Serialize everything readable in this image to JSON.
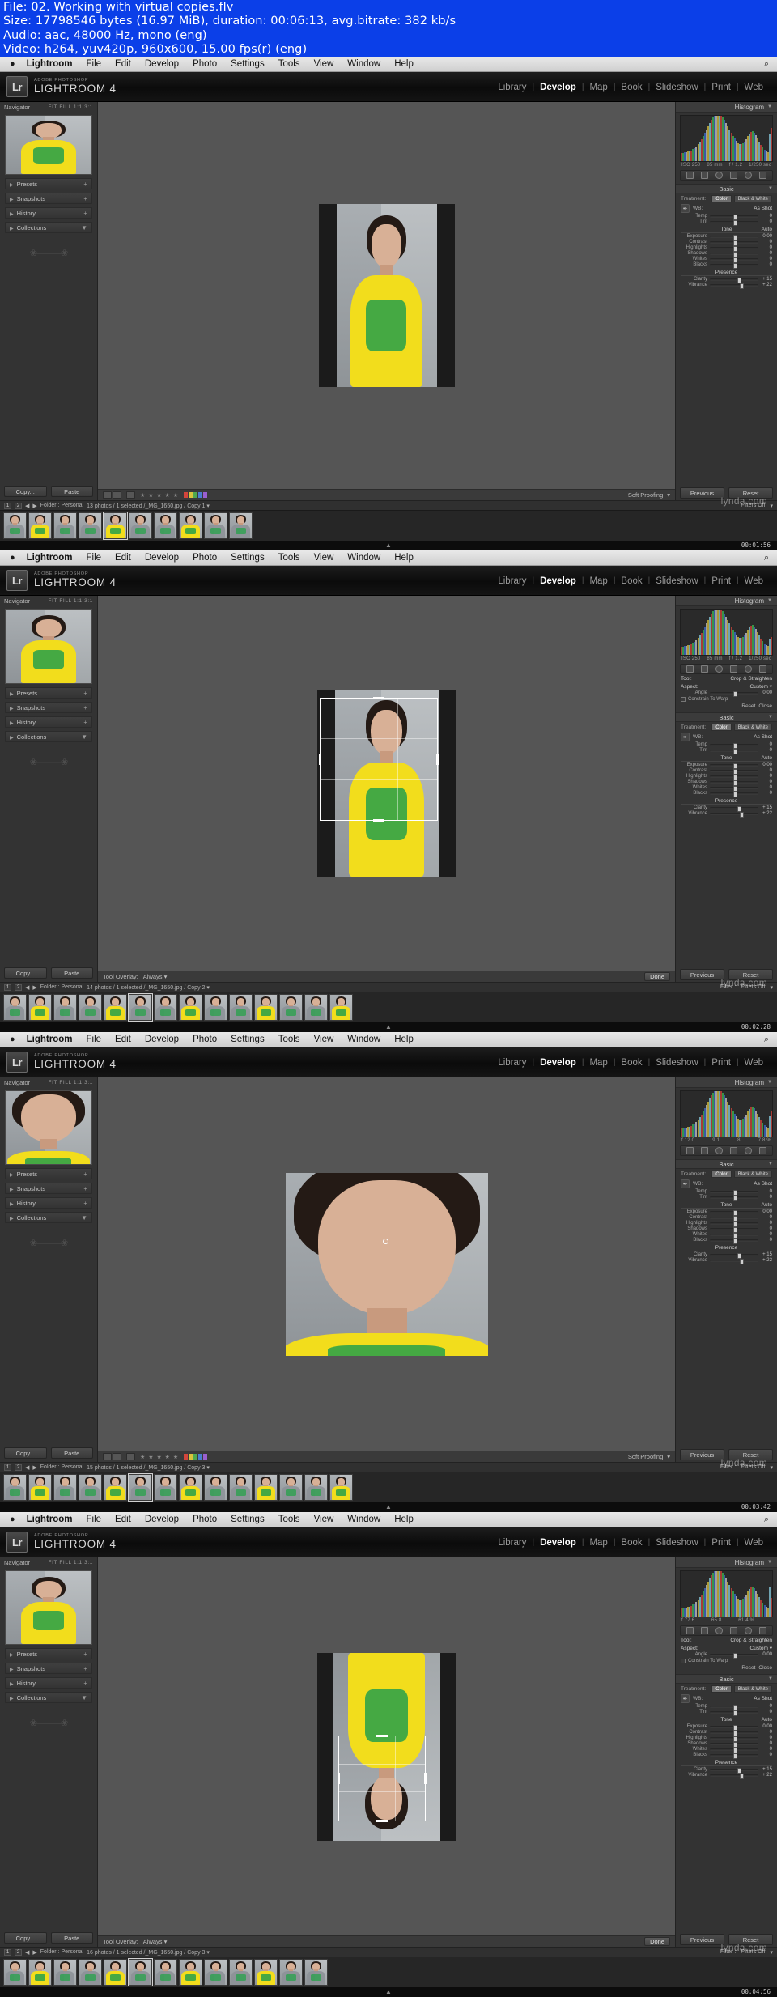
{
  "mediainfo": {
    "line1": "File: 02. Working with virtual copies.flv",
    "line2": "Size: 17798546 bytes (16.97 MiB), duration: 00:06:13, avg.bitrate: 382 kb/s",
    "line3": "Audio: aac, 48000 Hz, mono (eng)",
    "line4": "Video: h264, yuv420p, 960x600, 15.00 fps(r) (eng)"
  },
  "macmenu": {
    "apple": "apple-logo",
    "items": [
      "Lightroom",
      "File",
      "Edit",
      "Develop",
      "Photo",
      "Settings",
      "Tools",
      "View",
      "Window",
      "Help"
    ],
    "right_glyph": "search-icon"
  },
  "brand": {
    "logo": "Lr",
    "superscript": "ADOBE PHOTOSHOP",
    "name": "LIGHTROOM 4"
  },
  "modules": {
    "items": [
      "Library",
      "Develop",
      "Map",
      "Book",
      "Slideshow",
      "Print",
      "Web"
    ],
    "active": "Develop"
  },
  "left_panel": {
    "navigator_title": "Navigator",
    "zoom_levels": "FIT  FILL  1:1  3:1",
    "rows": [
      "Presets",
      "Snapshots",
      "History",
      "Collections"
    ],
    "copy_label": "Copy...",
    "paste_label": "Paste"
  },
  "right_panel": {
    "histogram_title": "Histogram",
    "basic_title": "Basic",
    "tool_label": "Tool:",
    "tool_value": "Crop & Straighten",
    "aspect_label": "Aspect:",
    "aspect_value": "Custom",
    "angle_label": "Angle",
    "angle_value": "0.00",
    "constrain_label": "Constrain To Warp",
    "reset_label": "Reset",
    "close_label": "Close",
    "treatment_label": "Treatment:",
    "treatment_color": "Color",
    "treatment_bw": "Black & White",
    "wb_label": "WB:",
    "wb_value": "As Shot",
    "temp_label": "Temp",
    "tint_label": "Tint",
    "tone_label": "Tone",
    "auto_label": "Auto",
    "presence_label": "Presence",
    "previous_label": "Previous",
    "reset_button": "Reset",
    "done_label": "Done",
    "sliders_tone": [
      {
        "name": "Exposure",
        "value": "0.00"
      },
      {
        "name": "Contrast",
        "value": "0"
      },
      {
        "name": "Highlights",
        "value": "0"
      },
      {
        "name": "Shadows",
        "value": "0"
      },
      {
        "name": "Whites",
        "value": "0"
      },
      {
        "name": "Blacks",
        "value": "0"
      }
    ],
    "sliders_presence": [
      {
        "name": "Clarity",
        "value": "+ 15"
      },
      {
        "name": "Vibrance",
        "value": "+ 22"
      }
    ],
    "wb_sliders": [
      {
        "name": "Temp",
        "value": "0"
      },
      {
        "name": "Tint",
        "value": "0"
      }
    ]
  },
  "toolbar": {
    "soft_proofing": "Soft Proofing",
    "tool_overlay_label": "Tool Overlay:",
    "tool_overlay_value": "Always",
    "done": "Done",
    "rating_stars": "★ ★ ★ ★ ★"
  },
  "shots": [
    {
      "id": "shot-1",
      "hist_meta_left": "ISO 250",
      "hist_meta_mid": "85 mm",
      "hist_meta_f": "f / 1.2",
      "hist_meta_right": "1/250 sec",
      "filmstrip_folder": "Folder : Personal",
      "filmstrip_count": "13 photos / 1 selected /_MG_1650.jpg / Copy 1",
      "filter_label": "Filters Off",
      "timecode": "00:01:56",
      "watermark": "lynda.com",
      "mode": "normal",
      "thumbs": 10,
      "selected_thumb": 4
    },
    {
      "id": "shot-2",
      "hist_meta_left": "ISO 250",
      "hist_meta_mid": "85 mm",
      "hist_meta_f": "f / 1.2",
      "hist_meta_right": "1/250 sec",
      "filmstrip_folder": "Folder : Personal",
      "filmstrip_count": "14 photos / 1 selected /_MG_1650.jpg / Copy 2",
      "filter_label": "Filters Off",
      "filter_prefix": "Filter :",
      "timecode": "00:02:28",
      "watermark": "lynda.com",
      "mode": "crop",
      "thumbs": 14,
      "selected_thumb": 5
    },
    {
      "id": "shot-3",
      "hist_meta_left": "f  12.0",
      "hist_meta_mid": "9.1",
      "hist_meta_f": "8",
      "hist_meta_right": "7.8 %",
      "filmstrip_folder": "Folder : Personal",
      "filmstrip_count": "15 photos / 1 selected /_MG_1650.jpg / Copy 3",
      "filter_label": "Filters Off",
      "filter_prefix": "Filter :",
      "timecode": "00:03:42",
      "watermark": "lynda.com",
      "mode": "zoomed",
      "thumbs": 14,
      "selected_thumb": 5
    },
    {
      "id": "shot-4",
      "hist_meta_left": "f  77.6",
      "hist_meta_mid": "65.8",
      "hist_meta_f": "61.4 %",
      "hist_meta_right": "",
      "filmstrip_folder": "Folder : Personal",
      "filmstrip_count": "16 photos / 1 selected /_MG_1650.jpg / Copy 3",
      "filter_label": "Filters Off",
      "filter_prefix": "Filter :",
      "timecode": "00:04:56",
      "watermark": "lynda.com",
      "mode": "flipped-crop",
      "thumbs": 13,
      "selected_thumb": 5
    }
  ],
  "colors": {
    "accent_blue": "#0b3fe8",
    "panel_bg": "#333333",
    "stage_bg": "#555555",
    "shirt_yellow": "#f2dd1c",
    "graphic_green": "#27a04a"
  }
}
